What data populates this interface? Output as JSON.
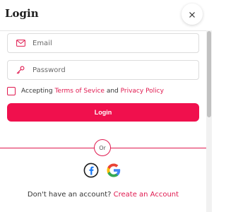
{
  "dialog": {
    "title": "Login",
    "close_icon": "close-icon"
  },
  "form": {
    "email_placeholder": "Email",
    "password_placeholder": "Password",
    "email_icon": "envelope-icon",
    "password_icon": "key-icon",
    "terms_prefix": "Accepting",
    "terms_link": "Terms of Sevice",
    "terms_and": "and",
    "privacy_link": "Privacy Policy",
    "checkbox_checked": false,
    "login_label": "Login"
  },
  "divider": {
    "label": "Or"
  },
  "social": {
    "facebook_icon": "facebook-icon",
    "google_icon": "google-icon"
  },
  "signup": {
    "prompt": "Don't have an account?",
    "link": "Create an Account"
  },
  "colors": {
    "accent": "#f0104d",
    "link": "#e0194f",
    "scroll_thumb": "#c1c1c1"
  }
}
